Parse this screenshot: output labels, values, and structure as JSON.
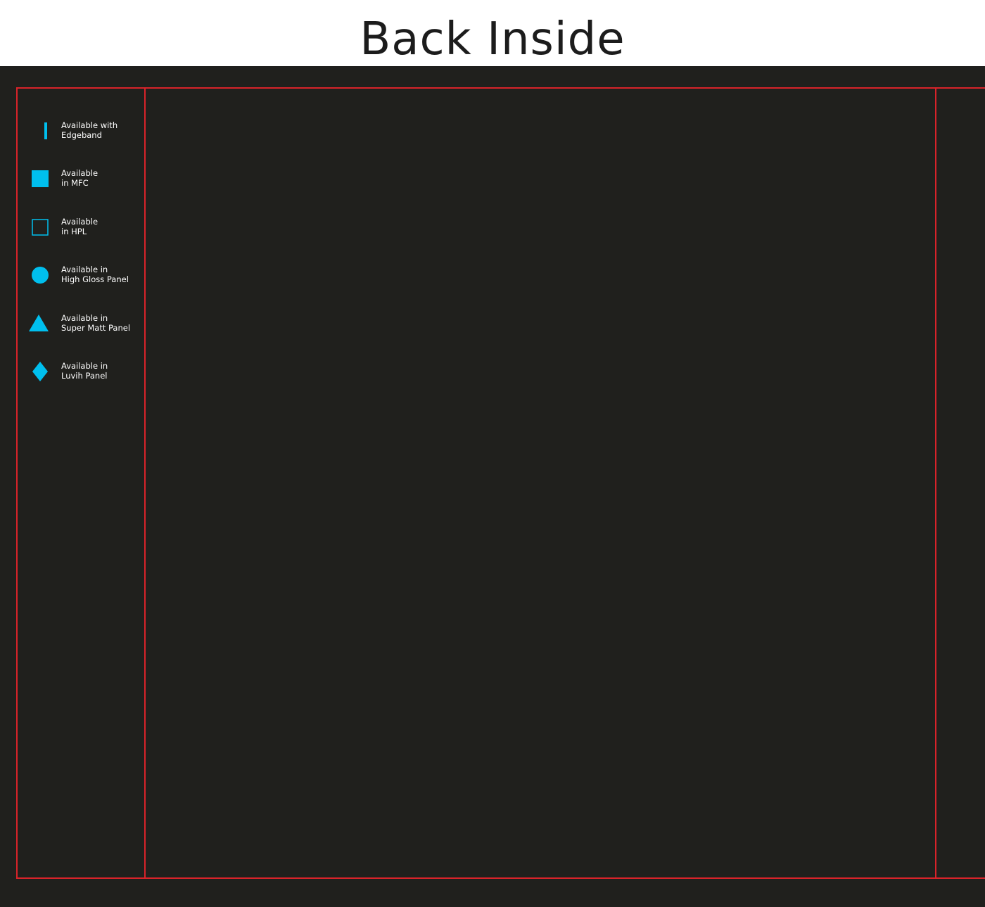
{
  "page": {
    "title": "Back Inside"
  },
  "colors": {
    "background": "#20201d",
    "title_background": "#ffffff",
    "title_text": "#1c1c1c",
    "guide_lines": "#d8232a",
    "icon_accent": "#00bfee",
    "label_text": "#ffffff"
  },
  "legend": {
    "items": [
      {
        "icon": "edgeband-bar-icon",
        "line1": "Available with",
        "line2": "Edgeband"
      },
      {
        "icon": "filled-square-icon",
        "line1": "Available",
        "line2": "in MFC"
      },
      {
        "icon": "outline-square-icon",
        "line1": "Available",
        "line2": "in HPL"
      },
      {
        "icon": "filled-circle-icon",
        "line1": "Available in",
        "line2": "High Gloss Panel"
      },
      {
        "icon": "filled-triangle-icon",
        "line1": "Available in",
        "line2": "Super Matt Panel"
      },
      {
        "icon": "filled-diamond-icon",
        "line1": "Available in",
        "line2": "Luvih Panel"
      }
    ]
  }
}
